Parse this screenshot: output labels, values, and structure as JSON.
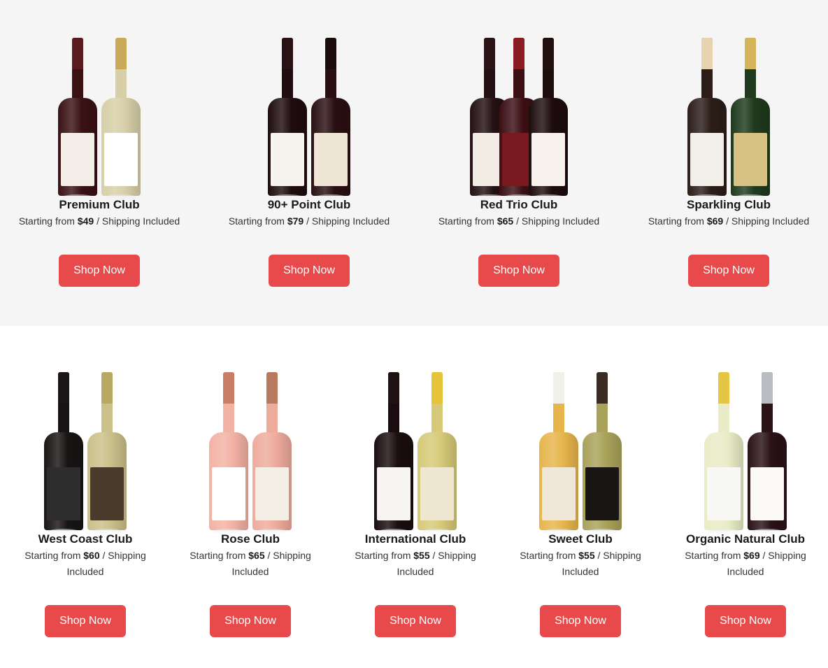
{
  "top_clubs": [
    {
      "name": "Premium Club",
      "price_prefix": "Starting from ",
      "price": "$49",
      "price_suffix": " / Shipping Included",
      "button": "Shop Now",
      "bottles": [
        {
          "color": "#3a1214",
          "cap": "#5a1a1e",
          "label": "#f3efe8"
        },
        {
          "color": "#d7cfa8",
          "cap": "#c9a95a",
          "label": "#ffffff"
        }
      ]
    },
    {
      "name": "90+ Point Club",
      "price_prefix": "Starting from ",
      "price": "$79",
      "price_suffix": " / Shipping Included",
      "button": "Shop Now",
      "bottles": [
        {
          "color": "#1f0c0e",
          "cap": "#2a1214",
          "label": "#f7f4ee"
        },
        {
          "color": "#2a0f12",
          "cap": "#1b0b0c",
          "label": "#efe6d6"
        }
      ]
    },
    {
      "name": "Red Trio Club",
      "price_prefix": "Starting from ",
      "price": "$65",
      "price_suffix": " / Shipping Included",
      "button": "Shop Now",
      "bottles": [
        {
          "color": "#231012",
          "cap": "#2b1416",
          "label": "#f1ede4"
        },
        {
          "color": "#3b0f14",
          "cap": "#8a1c24",
          "label": "#7a1a20"
        },
        {
          "color": "#1d0c0d",
          "cap": "#221011",
          "label": "#f7f3ec"
        }
      ]
    },
    {
      "name": "Sparkling Club",
      "price_prefix": "Starting from ",
      "price": "$69",
      "price_suffix": " / Shipping Included",
      "button": "Shop Now",
      "bottles": [
        {
          "color": "#2c1d18",
          "cap": "#e7d3b0",
          "label": "#f3f0ea"
        },
        {
          "color": "#1f3a1d",
          "cap": "#d4b55c",
          "label": "#d8c283"
        }
      ]
    }
  ],
  "bottom_clubs": [
    {
      "name": "West Coast Club",
      "price_prefix": "Starting from ",
      "price": "$60",
      "price_suffix": " / Shipping",
      "price_line2": "Included",
      "button": "Shop Now",
      "bottles": [
        {
          "color": "#181414",
          "cap": "#1c1717",
          "label": "#2d2d2d"
        },
        {
          "color": "#c9c08a",
          "cap": "#b9a863",
          "label": "#4a3b2c"
        }
      ]
    },
    {
      "name": "Rose Club",
      "price_prefix": "Starting from ",
      "price": "$65",
      "price_suffix": " / Shipping",
      "price_line2": "Included",
      "button": "Shop Now",
      "bottles": [
        {
          "color": "#f2b2a4",
          "cap": "#c97f66",
          "label": "#ffffff"
        },
        {
          "color": "#eeab9c",
          "cap": "#b87a5f",
          "label": "#f4efe6"
        }
      ]
    },
    {
      "name": "International Club",
      "price_prefix": "Starting from ",
      "price": "$55",
      "price_suffix": " / Shipping",
      "price_line2": "Included",
      "button": "Shop Now",
      "bottles": [
        {
          "color": "#1a0d0f",
          "cap": "#1e1213",
          "label": "#f7f5f1"
        },
        {
          "color": "#d6c978",
          "cap": "#e5c43a",
          "label": "#efe7d2"
        }
      ]
    },
    {
      "name": "Sweet Club",
      "price_prefix": "Starting from ",
      "price": "$55",
      "price_suffix": " / Shipping",
      "price_line2": "Included",
      "button": "Shop Now",
      "bottles": [
        {
          "color": "#e6b54c",
          "cap": "#f2f0ea",
          "label": "#efe8d8"
        },
        {
          "color": "#a9a25a",
          "cap": "#3a2c22",
          "label": "#1a1616"
        }
      ]
    },
    {
      "name": "Organic Natural Club",
      "price_prefix": "Starting from ",
      "price": "$69",
      "price_suffix": " / Shipping",
      "price_line2": "Included",
      "button": "Shop Now",
      "bottles": [
        {
          "color": "#e9ecc6",
          "cap": "#e3c646",
          "label": "#f7f7f3"
        },
        {
          "color": "#2a1216",
          "cap": "#b9bcc0",
          "label": "#fbfaf7"
        }
      ]
    }
  ]
}
